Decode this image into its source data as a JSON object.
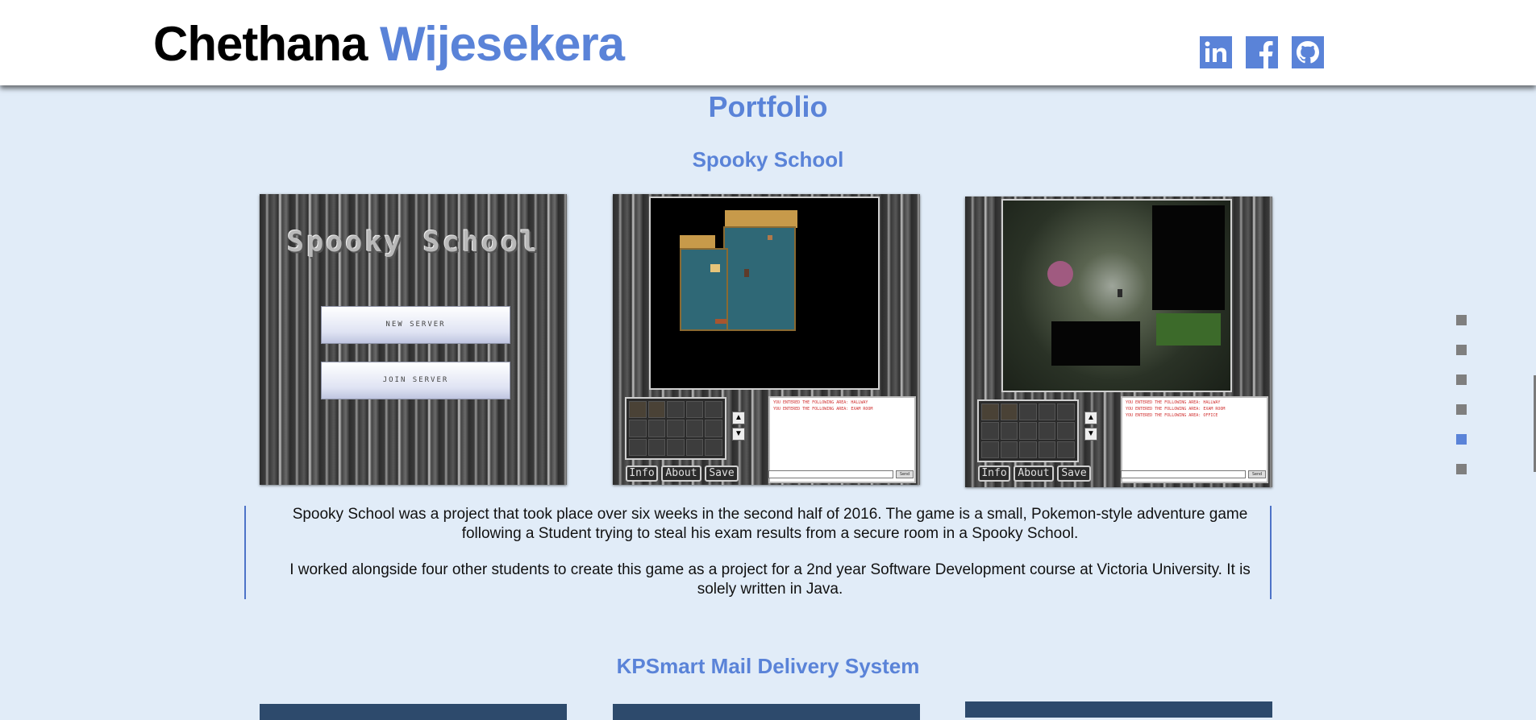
{
  "header": {
    "first_name": "Chethana",
    "last_name": "Wijesekera",
    "social": [
      {
        "name": "linkedin",
        "icon": "linkedin-icon"
      },
      {
        "name": "facebook",
        "icon": "facebook-icon"
      },
      {
        "name": "github",
        "icon": "github-icon"
      }
    ]
  },
  "portfolio": {
    "title": "Portfolio",
    "projects": [
      {
        "title": "Spooky School",
        "screens": {
          "menu_title": "Spooky School",
          "new_server": "NEW SERVER",
          "join_server": "JOIN SERVER",
          "buttons": [
            "Info",
            "About",
            "Save"
          ]
        },
        "description": [
          "Spooky School was a project that took place over six weeks in the second half of 2016. The game is a small, Pokemon-style adventure game following a Student trying to steal his exam results from a secure room in a Spooky School.",
          "I worked alongside four other students to create this game as a project for a 2nd year Software Development course at Victoria University. It is solely written in Java."
        ]
      },
      {
        "title": "KPSmart Mail Delivery System"
      }
    ]
  },
  "side_nav": {
    "count": 6,
    "active_index": 4
  },
  "colors": {
    "accent": "#5a83d8",
    "background": "#e1ecf8",
    "header": "#ffffff"
  }
}
